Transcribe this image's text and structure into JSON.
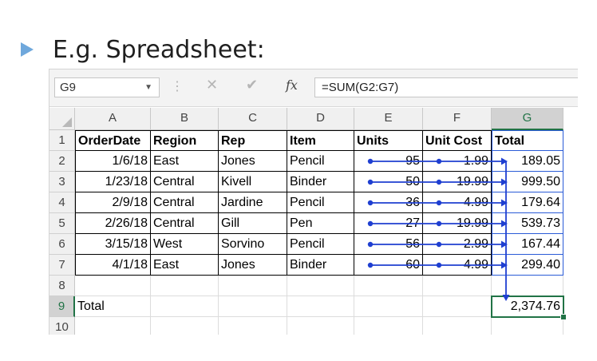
{
  "slide": {
    "title": "E.g. Spreadsheet:"
  },
  "formula_bar": {
    "name_box": "G9",
    "cancel_icon": "✕",
    "enter_icon": "✔",
    "fx_label": "fx",
    "formula": "=SUM(G2:G7)"
  },
  "columns": [
    "A",
    "B",
    "C",
    "D",
    "E",
    "F",
    "G"
  ],
  "rows": [
    "1",
    "2",
    "3",
    "4",
    "5",
    "6",
    "7",
    "8",
    "9",
    "10"
  ],
  "table": {
    "headers": [
      "OrderDate",
      "Region",
      "Rep",
      "Item",
      "Units",
      "Unit Cost",
      "Total"
    ],
    "data": [
      [
        "1/6/18",
        "East",
        "Jones",
        "Pencil",
        "95",
        "1.99",
        "189.05"
      ],
      [
        "1/23/18",
        "Central",
        "Kivell",
        "Binder",
        "50",
        "19.99",
        "999.50"
      ],
      [
        "2/9/18",
        "Central",
        "Jardine",
        "Pencil",
        "36",
        "4.99",
        "179.64"
      ],
      [
        "2/26/18",
        "Central",
        "Gill",
        "Pen",
        "27",
        "19.99",
        "539.73"
      ],
      [
        "3/15/18",
        "West",
        "Sorvino",
        "Pencil",
        "56",
        "2.99",
        "167.44"
      ],
      [
        "4/1/18",
        "East",
        "Jones",
        "Binder",
        "60",
        "4.99",
        "299.40"
      ]
    ],
    "total_label": "Total",
    "total_value": "2,374.76"
  },
  "colors": {
    "accent": "#217346",
    "trace_arrow": "#1f3fd1",
    "bullet": "#6fa8dc"
  }
}
